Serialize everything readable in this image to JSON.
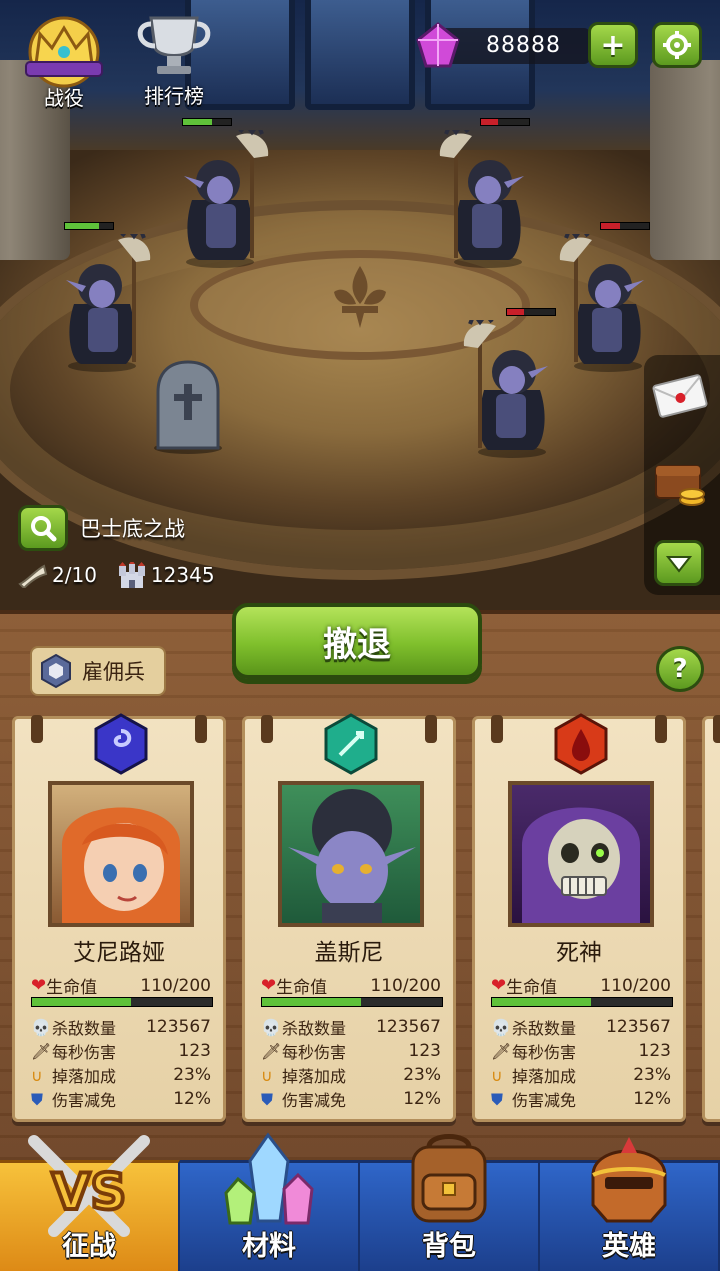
{
  "hud": {
    "campaign_label": "战役",
    "leaderboard_label": "排行榜",
    "gems": "88888",
    "add_icon": "plus-icon",
    "settings_icon": "gear-icon"
  },
  "battle": {
    "name": "巴士底之战",
    "progress": "2/10",
    "castle_value": "12345"
  },
  "units": {
    "left": [
      {
        "hp": 0.6
      },
      {
        "hp": 0.7
      }
    ],
    "right": [
      {
        "hp": 0.35
      },
      {
        "hp": 0.4
      },
      {
        "hp": 0.35
      }
    ]
  },
  "actions": {
    "retreat_label": "撤退",
    "mercenary_label": "雇佣兵",
    "help_label": "?"
  },
  "heroes": [
    {
      "name": "艾尼路娅",
      "element": "arcane",
      "hp_label": "生命值",
      "hp_value": "110/200",
      "hp_ratio": 0.55,
      "kills_label": "杀敌数量",
      "kills_value": "123567",
      "dps_label": "每秒伤害",
      "dps_value": "123",
      "drop_label": "掉落加成",
      "drop_value": "23%",
      "reduce_label": "伤害减免",
      "reduce_value": "12%"
    },
    {
      "name": "盖斯尼",
      "element": "nature",
      "hp_label": "生命值",
      "hp_value": "110/200",
      "hp_ratio": 0.55,
      "kills_label": "杀敌数量",
      "kills_value": "123567",
      "dps_label": "每秒伤害",
      "dps_value": "123",
      "drop_label": "掉落加成",
      "drop_value": "23%",
      "reduce_label": "伤害减免",
      "reduce_value": "12%"
    },
    {
      "name": "死神",
      "element": "blood",
      "hp_label": "生命值",
      "hp_value": "110/200",
      "hp_ratio": 0.55,
      "kills_label": "杀敌数量",
      "kills_value": "123567",
      "dps_label": "每秒伤害",
      "dps_value": "123",
      "drop_label": "掉落加成",
      "drop_value": "23%",
      "reduce_label": "伤害减免",
      "reduce_value": "12%"
    }
  ],
  "nav": [
    {
      "label": "征战",
      "icon": "crossed-swords-vs-icon",
      "active": true
    },
    {
      "label": "材料",
      "icon": "crystals-icon",
      "active": false
    },
    {
      "label": "背包",
      "icon": "backpack-icon",
      "active": false
    },
    {
      "label": "英雄",
      "icon": "helmet-icon",
      "active": false
    }
  ],
  "colors": {
    "accent_green": "#7fbf2c",
    "hp_green": "#5fc23a",
    "hp_red": "#c8202a",
    "nav_blue": "#2f66c9",
    "nav_active": "#f7c23b"
  }
}
